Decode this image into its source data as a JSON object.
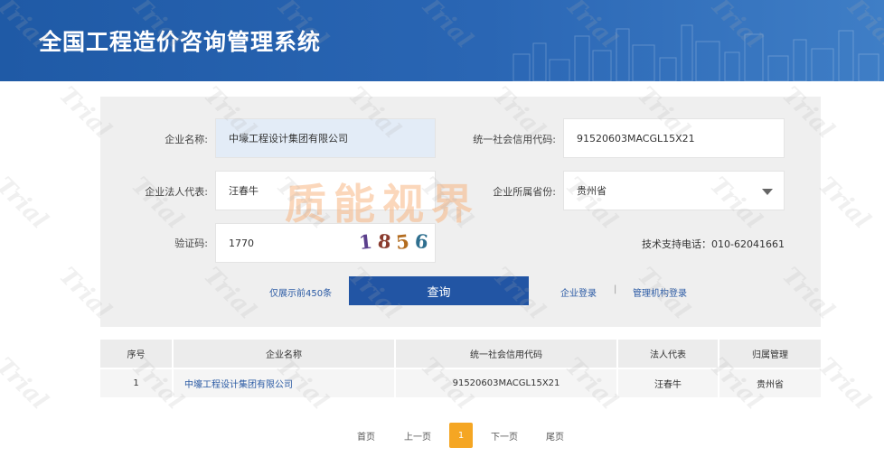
{
  "header": {
    "title": "全国工程造价咨询管理系统"
  },
  "form": {
    "company_name_label": "企业名称:",
    "company_name_value": "中壕工程设计集团有限公司",
    "credit_code_label": "统一社会信用代码:",
    "credit_code_value": "91520603MACGL15X21",
    "legal_rep_label": "企业法人代表:",
    "legal_rep_value": "汪春牛",
    "province_label": "企业所属省份:",
    "province_value": "贵州省",
    "captcha_label": "验证码:",
    "captcha_input": "1770",
    "captcha_digits": [
      "1",
      "8",
      "5",
      "6"
    ],
    "captcha_colors": [
      "#5b3f8c",
      "#8a3b2e",
      "#b36c1f",
      "#2f6f8f"
    ],
    "support_text": "技术支持电话：010-62041661",
    "limit_text": "仅展示前450条",
    "query_button": "查询",
    "company_login": "企业登录",
    "separator": "|",
    "admin_login": "管理机构登录"
  },
  "watermark": {
    "stamp": "质能视界",
    "trial": "Trial"
  },
  "table": {
    "headers": [
      "序号",
      "企业名称",
      "统一社会信用代码",
      "法人代表",
      "归属管理"
    ],
    "rows": [
      [
        "1",
        "中壕工程设计集团有限公司",
        "91520603MACGL15X21",
        "汪春牛",
        "贵州省"
      ]
    ]
  },
  "pagination": {
    "first": "首页",
    "prev": "上一页",
    "current": "1",
    "next": "下一页",
    "last": "尾页"
  },
  "colors": {
    "header_blue": "#1f5aa6",
    "button_blue": "#2255a4",
    "link_blue": "#2a5aa4",
    "pager_active": "#f5a623"
  }
}
